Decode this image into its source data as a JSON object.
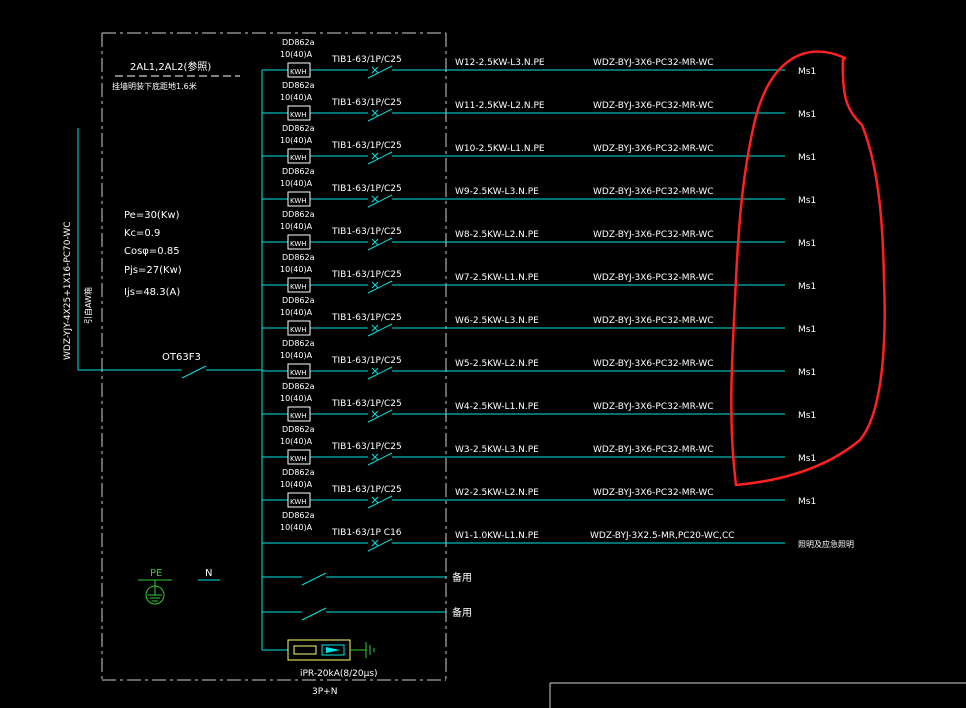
{
  "panel": {
    "title": "2AL1,2AL2(参照)",
    "subtitle": "挂墙明装下底距地1.6米",
    "incoming_cable": "WDZ-YJY-4X25+1X16-PC70-WC",
    "incoming_source": "引自AW箱",
    "main_switch": "OT63F3",
    "pe_label": "PE",
    "n_label": "N"
  },
  "load_params": [
    "Pe=30(Kw)",
    "Kc=0.9",
    "Cosφ=0.85",
    "Pjs=27(Kw)",
    "Ijs=48.3(A)"
  ],
  "meter": {
    "model": "DD862a",
    "rating": "10(40)A",
    "unit": "KWH"
  },
  "circuits": [
    {
      "breaker": "TIB1-63/1P/C25",
      "circuit": "W12-2.5KW-L3.N.PE",
      "cable": "WDZ-BYJ-3X6-PC32-MR-WC",
      "load": "Ms1",
      "metered": true
    },
    {
      "breaker": "TIB1-63/1P/C25",
      "circuit": "W11-2.5KW-L2.N.PE",
      "cable": "WDZ-BYJ-3X6-PC32-MR-WC",
      "load": "Ms1",
      "metered": true
    },
    {
      "breaker": "TIB1-63/1P/C25",
      "circuit": "W10-2.5KW-L1.N.PE",
      "cable": "WDZ-BYJ-3X6-PC32-MR-WC",
      "load": "Ms1",
      "metered": true
    },
    {
      "breaker": "TIB1-63/1P/C25",
      "circuit": "W9-2.5KW-L3.N.PE",
      "cable": "WDZ-BYJ-3X6-PC32-MR-WC",
      "load": "Ms1",
      "metered": true
    },
    {
      "breaker": "TIB1-63/1P/C25",
      "circuit": "W8-2.5KW-L2.N.PE",
      "cable": "WDZ-BYJ-3X6-PC32-MR-WC",
      "load": "Ms1",
      "metered": true
    },
    {
      "breaker": "TIB1-63/1P/C25",
      "circuit": "W7-2.5KW-L1.N.PE",
      "cable": "WDZ-BYJ-3X6-PC32-MR-WC",
      "load": "Ms1",
      "metered": true
    },
    {
      "breaker": "TIB1-63/1P/C25",
      "circuit": "W6-2.5KW-L3.N.PE",
      "cable": "WDZ-BYJ-3X6-PC32-MR-WC",
      "load": "Ms1",
      "metered": true
    },
    {
      "breaker": "TIB1-63/1P/C25",
      "circuit": "W5-2.5KW-L2.N.PE",
      "cable": "WDZ-BYJ-3X6-PC32-MR-WC",
      "load": "Ms1",
      "metered": true
    },
    {
      "breaker": "TIB1-63/1P/C25",
      "circuit": "W4-2.5KW-L1.N.PE",
      "cable": "WDZ-BYJ-3X6-PC32-MR-WC",
      "load": "Ms1",
      "metered": true
    },
    {
      "breaker": "TIB1-63/1P/C25",
      "circuit": "W3-2.5KW-L3.N.PE",
      "cable": "WDZ-BYJ-3X6-PC32-MR-WC",
      "load": "Ms1",
      "metered": true
    },
    {
      "breaker": "TIB1-63/1P/C25",
      "circuit": "W2-2.5KW-L2.N.PE",
      "cable": "WDZ-BYJ-3X6-PC32-MR-WC",
      "load": "Ms1",
      "metered": true
    },
    {
      "breaker": "TIB1-63/1P C16",
      "circuit": "W1-1.0KW-L1.N.PE",
      "cable": "WDZ-BYJ-3X2.5-MR,PC20-WC,CC",
      "load": "照明及应急照明",
      "metered": false
    }
  ],
  "spares": [
    "备用",
    "备用"
  ],
  "spd": {
    "label": "iPR-20kA(8/20μs)",
    "poles": "3P+N"
  },
  "colors": {
    "wire": "#00e5e5",
    "text": "#ffffff",
    "annotation": "#ff2020",
    "meter_box": "#ffff66",
    "ground": "#33cc33"
  }
}
